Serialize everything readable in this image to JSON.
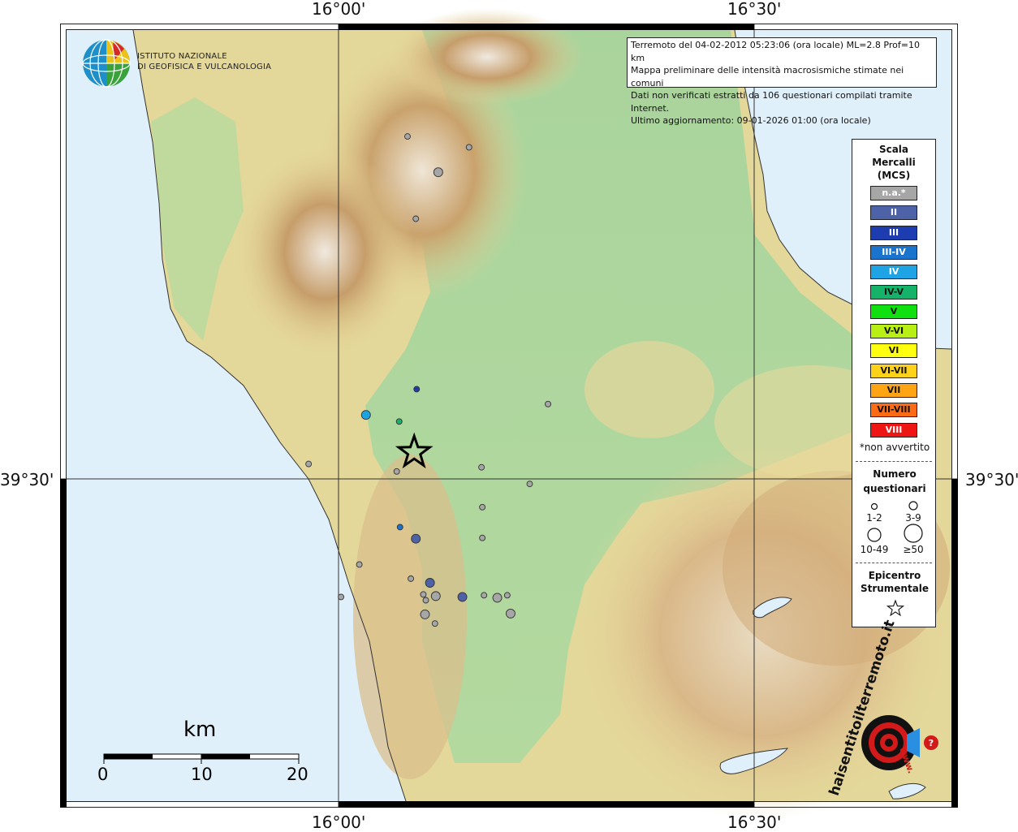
{
  "coords": {
    "top_left": "16°00'",
    "top_right": "16°30'",
    "bottom_left": "16°00'",
    "bottom_right": "16°30'",
    "left_mid": "39°30'",
    "right_mid": "39°30'"
  },
  "logo": {
    "line1": "ISTITUTO NAZIONALE",
    "line2": "DI GEOFISICA E VULCANOLOGIA"
  },
  "info": {
    "line1": "Terremoto del 04-02-2012 05:23:06 (ora locale) ML=2.8 Prof=10 km",
    "line2": "Mappa preliminare delle intensità macrosismiche stimate nei comuni",
    "line3": "Dati non verificati estratti da 106 questionari compilati tramite Internet.",
    "line4": "Ultimo aggiornamento: 09-01-2026 01:00 (ora locale)"
  },
  "legend": {
    "title1": "Scala",
    "title2": "Mercalli",
    "title3": "(MCS)",
    "levels": [
      {
        "label": "n.a.*",
        "color": "#a6a6a6",
        "text": "#ffffff"
      },
      {
        "label": "II",
        "color": "#4e62a8",
        "text": "#ffffff"
      },
      {
        "label": "III",
        "color": "#1c3cb0",
        "text": "#ffffff"
      },
      {
        "label": "III-IV",
        "color": "#1a73cc",
        "text": "#ffffff"
      },
      {
        "label": "IV",
        "color": "#1ea4e4",
        "text": "#ffffff"
      },
      {
        "label": "IV-V",
        "color": "#15b36a",
        "text": "#111111"
      },
      {
        "label": "V",
        "color": "#10e010",
        "text": "#111111"
      },
      {
        "label": "V-VI",
        "color": "#b8f015",
        "text": "#111111"
      },
      {
        "label": "VI",
        "color": "#ffff10",
        "text": "#111111"
      },
      {
        "label": "VI-VII",
        "color": "#ffd21a",
        "text": "#111111"
      },
      {
        "label": "VII",
        "color": "#ffa514",
        "text": "#111111"
      },
      {
        "label": "VII-VIII",
        "color": "#ff6a14",
        "text": "#111111"
      },
      {
        "label": "VIII",
        "color": "#ee1515",
        "text": "#ffffff"
      }
    ],
    "note": "*non avvertito",
    "questionnaires_title1": "Numero",
    "questionnaires_title2": "questionari",
    "sizes": [
      "1-2",
      "3-9",
      "10-49",
      "≥50"
    ],
    "epicenter_title1": "Epicentro",
    "epicenter_title2": "Strumentale"
  },
  "scalebar": {
    "unit": "km",
    "labels": [
      "0",
      "10",
      "20"
    ]
  },
  "watermark": {
    "text": "haisentitoilterremoto.it",
    "www": "www."
  },
  "observations": [
    {
      "lon": 16.083,
      "lat": 39.912,
      "level": "n.a.*",
      "size": "1-2"
    },
    {
      "lon": 16.157,
      "lat": 39.899,
      "level": "n.a.*",
      "size": "1-2"
    },
    {
      "lon": 16.12,
      "lat": 39.869,
      "level": "n.a.*",
      "size": "3-9"
    },
    {
      "lon": 16.093,
      "lat": 39.813,
      "level": "n.a.*",
      "size": "1-2"
    },
    {
      "lon": 16.094,
      "lat": 39.608,
      "level": "III",
      "size": "1-2"
    },
    {
      "lon": 16.033,
      "lat": 39.577,
      "level": "IV",
      "size": "3-9"
    },
    {
      "lon": 16.073,
      "lat": 39.569,
      "level": "IV-V",
      "size": "1-2"
    },
    {
      "lon": 16.252,
      "lat": 39.59,
      "level": "n.a.*",
      "size": "1-2"
    },
    {
      "lon": 15.964,
      "lat": 39.518,
      "level": "n.a.*",
      "size": "1-2"
    },
    {
      "lon": 16.07,
      "lat": 39.509,
      "level": "n.a.*",
      "size": "1-2"
    },
    {
      "lon": 16.172,
      "lat": 39.514,
      "level": "n.a.*",
      "size": "1-2"
    },
    {
      "lon": 16.23,
      "lat": 39.494,
      "level": "n.a.*",
      "size": "1-2"
    },
    {
      "lon": 16.173,
      "lat": 39.466,
      "level": "n.a.*",
      "size": "1-2"
    },
    {
      "lon": 16.074,
      "lat": 39.442,
      "level": "III-IV",
      "size": "1-2"
    },
    {
      "lon": 16.093,
      "lat": 39.428,
      "level": "II",
      "size": "3-9"
    },
    {
      "lon": 16.173,
      "lat": 39.429,
      "level": "n.a.*",
      "size": "1-2"
    },
    {
      "lon": 16.025,
      "lat": 39.397,
      "level": "n.a.*",
      "size": "1-2"
    },
    {
      "lon": 16.087,
      "lat": 39.38,
      "level": "n.a.*",
      "size": "1-2"
    },
    {
      "lon": 16.11,
      "lat": 39.375,
      "level": "II",
      "size": "3-9"
    },
    {
      "lon": 16.102,
      "lat": 39.361,
      "level": "n.a.*",
      "size": "1-2"
    },
    {
      "lon": 16.117,
      "lat": 39.359,
      "level": "n.a.*",
      "size": "3-9"
    },
    {
      "lon": 16.149,
      "lat": 39.358,
      "level": "II",
      "size": "3-9"
    },
    {
      "lon": 16.175,
      "lat": 39.36,
      "level": "n.a.*",
      "size": "1-2"
    },
    {
      "lon": 16.191,
      "lat": 39.357,
      "level": "n.a.*",
      "size": "3-9"
    },
    {
      "lon": 16.203,
      "lat": 39.36,
      "level": "n.a.*",
      "size": "1-2"
    },
    {
      "lon": 16.003,
      "lat": 39.358,
      "level": "n.a.*",
      "size": "1-2"
    },
    {
      "lon": 16.105,
      "lat": 39.354,
      "level": "n.a.*",
      "size": "1-2"
    },
    {
      "lon": 16.104,
      "lat": 39.337,
      "level": "n.a.*",
      "size": "3-9"
    },
    {
      "lon": 16.116,
      "lat": 39.326,
      "level": "n.a.*",
      "size": "1-2"
    },
    {
      "lon": 16.207,
      "lat": 39.338,
      "level": "n.a.*",
      "size": "3-9"
    }
  ],
  "epicenter": {
    "lon": 16.091,
    "lat": 39.532
  }
}
